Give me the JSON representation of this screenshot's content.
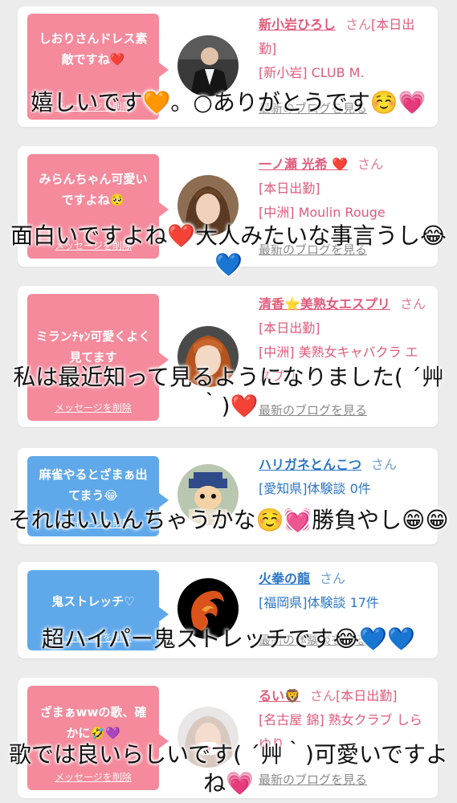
{
  "posts": [
    {
      "bubble_text": "しおりさんドレス素敵ですね❤️",
      "delete_label": "メッセージを削除",
      "name": "新小岩ひろし",
      "san": "さん",
      "status": "[本日出勤]",
      "location": "[新小岩] CLUB M.",
      "blog_label": "最新のブログを見る",
      "comment": "嬉しいです🧡。○ありがとうです☺️💗"
    },
    {
      "bubble_text": "みらんちゃん可愛いですよね🥺",
      "delete_label": "メッセージを削除",
      "name": "一ノ瀬 光希 ❤️",
      "san": "さん",
      "status": "[本日出勤]",
      "location": "[中洲] Moulin Rouge",
      "blog_label": "最新のブログを見る",
      "comment": "面白いですよね❤️大人みたいな事言うし😂💙"
    },
    {
      "bubble_text": "ミランﾁｬﾝ可愛くよく見てます",
      "delete_label": "メッセージを削除",
      "name": "清香⭐美熟女エスプリ",
      "san": "さん",
      "status": "[本日出勤]",
      "location": "[中洲] 美熟女キャバクラ エスプリ",
      "blog_label": "最新のブログを見る",
      "comment": "私は最近知って見るようになりました( ´艸｀)❤️"
    },
    {
      "bubble_text": "麻雀やるとざまぁ出てまう😂",
      "delete_label": "メッセージを削除",
      "name": "ハリガネとんこつ",
      "san": "さん",
      "status": "",
      "location": "[愛知県]体験談 0件",
      "blog_label": "",
      "comment": "それはいいんちゃうかな☺️💓勝負やし😁😁"
    },
    {
      "bubble_text": "鬼ストレッチ♡",
      "delete_label": "メッセージを削除",
      "name": "火拳の龍",
      "san": "さん",
      "status": "",
      "location": "[福岡県]体験談 17件",
      "blog_label": "最新の体験談を見る",
      "comment": "超ハイパー鬼ストレッチです😂💙💙"
    },
    {
      "bubble_text": "ざまぁwwの歌、確かに🤣💜",
      "delete_label": "メッセージを削除",
      "name": "るい🦁",
      "san": "さん",
      "status": "[本日出勤]",
      "location": "[名古屋 錦] 熟女クラブ しらゆり",
      "blog_label": "最新のブログを見る",
      "comment": "歌では良いらしいです( ´艸｀)可愛いですよね💗"
    }
  ]
}
